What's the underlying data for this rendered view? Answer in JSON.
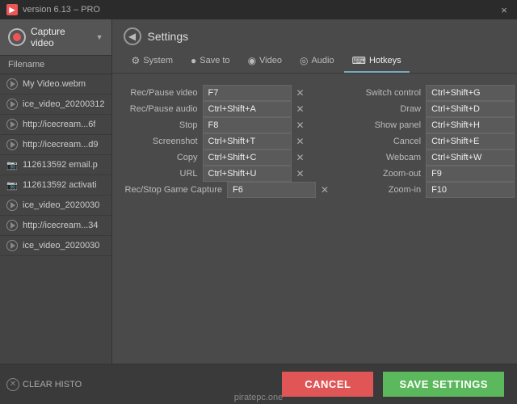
{
  "titlebar": {
    "version": "version 6.13 – PRO",
    "close_label": "×"
  },
  "sidebar": {
    "capture_label": "Capture video",
    "filename_header": "Filename",
    "files": [
      {
        "name": "My Video.webm",
        "type": "play"
      },
      {
        "name": "ice_video_20200312",
        "type": "play"
      },
      {
        "name": "http://icecream...6f",
        "type": "play"
      },
      {
        "name": "http://icecream...d9",
        "type": "play"
      },
      {
        "name": "112613592 email.p",
        "type": "camera"
      },
      {
        "name": "112613592 activati",
        "type": "camera"
      },
      {
        "name": "ice_video_2020030",
        "type": "play"
      },
      {
        "name": "http://icecream...34",
        "type": "play"
      },
      {
        "name": "ice_video_2020030",
        "type": "play"
      }
    ],
    "clear_history": "CLEAR HISTO"
  },
  "settings": {
    "title": "Settings",
    "back_label": "‹"
  },
  "tabs": [
    {
      "id": "system",
      "label": "System",
      "icon": "⚙"
    },
    {
      "id": "save-to",
      "label": "Save to",
      "icon": "●"
    },
    {
      "id": "video",
      "label": "Video",
      "icon": "◉"
    },
    {
      "id": "audio",
      "label": "Audio",
      "icon": "◎"
    },
    {
      "id": "hotkeys",
      "label": "Hotkeys",
      "icon": "⌨",
      "active": true
    }
  ],
  "hotkeys": {
    "left": [
      {
        "label": "Rec/Pause video",
        "value": "F7"
      },
      {
        "label": "Rec/Pause audio",
        "value": "Ctrl+Shift+A"
      },
      {
        "label": "Stop",
        "value": "F8"
      },
      {
        "label": "Screenshot",
        "value": "Ctrl+Shift+T"
      },
      {
        "label": "Copy",
        "value": "Ctrl+Shift+C"
      },
      {
        "label": "URL",
        "value": "Ctrl+Shift+U"
      },
      {
        "label": "Rec/Stop Game Capture",
        "value": "F6"
      }
    ],
    "right": [
      {
        "label": "Switch control",
        "value": "Ctrl+Shift+G"
      },
      {
        "label": "Draw",
        "value": "Ctrl+Shift+D"
      },
      {
        "label": "Show panel",
        "value": "Ctrl+Shift+H"
      },
      {
        "label": "Cancel",
        "value": "Ctrl+Shift+E"
      },
      {
        "label": "Webcam",
        "value": "Ctrl+Shift+W"
      },
      {
        "label": "Zoom-out",
        "value": "F9"
      },
      {
        "label": "Zoom-in",
        "value": "F10"
      }
    ]
  },
  "actions": {
    "cancel": "CANCEL",
    "save": "SAVE SETTINGS"
  },
  "watermark": "piratepc.one"
}
